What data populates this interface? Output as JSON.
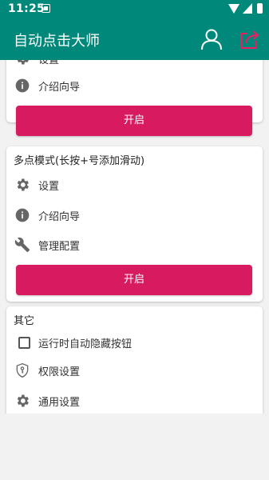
{
  "status_bar": {
    "time": "11:25"
  },
  "app_bar": {
    "title": "自动点击大师",
    "icons": [
      "user-icon",
      "share-icon"
    ]
  },
  "card_single": {
    "settings_label": "设置",
    "guide_label": "介绍向导",
    "start_button": "开启"
  },
  "card_multi": {
    "title": "多点模式(长按+号添加滑动)",
    "settings_label": "设置",
    "guide_label": "介绍向导",
    "manage_label": "管理配置",
    "start_button": "开启"
  },
  "card_other": {
    "title": "其它",
    "auto_hide_label": "运行时自动隐藏按钮",
    "auto_hide_checked": false,
    "permission_label": "权限设置",
    "general_label": "通用设置"
  },
  "colors": {
    "primary": "#00897b",
    "accent": "#d81b60",
    "background": "#f2f2f2"
  }
}
